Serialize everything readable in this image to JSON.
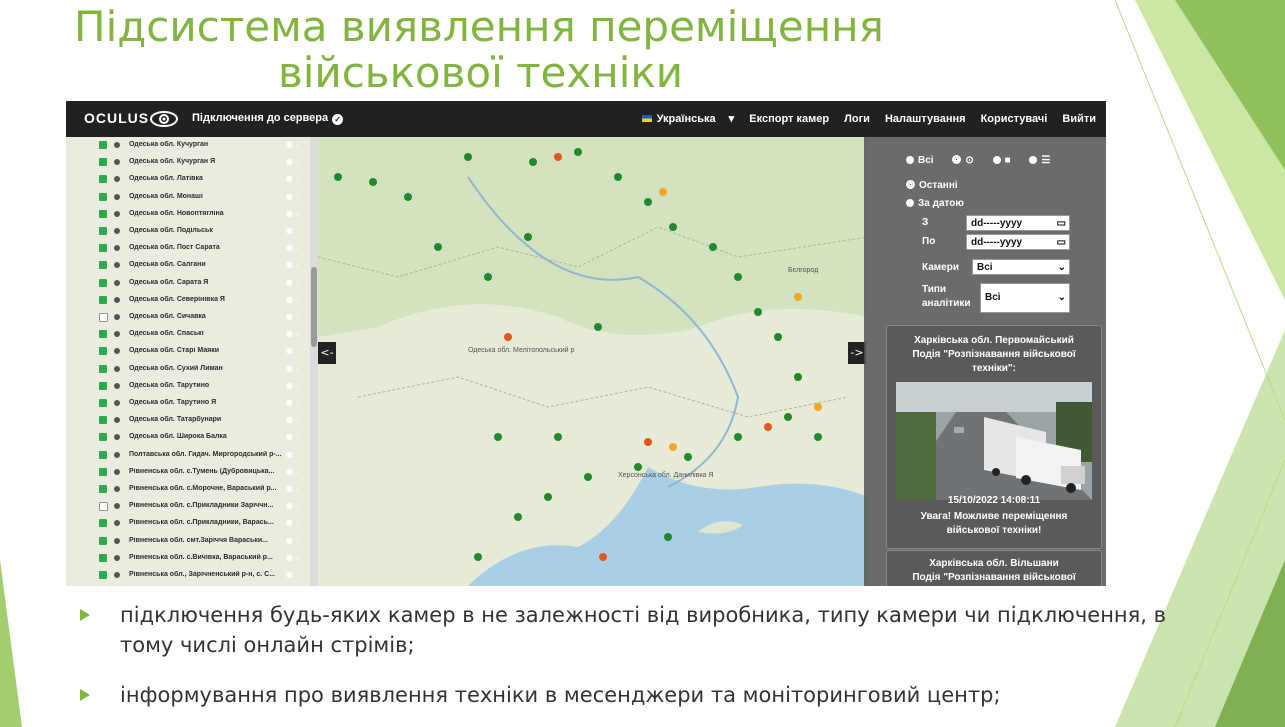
{
  "slide": {
    "title_line1": "Підсистема виявлення переміщення",
    "title_line2": "військової техніки",
    "accent_color": "#82b440",
    "bullets": [
      "підключення будь-яких камер в не залежності від виробника, типу камери чи підключення, в тому числі онлайн стрімів;",
      "інформування про виявлення техніки в месенджери та моніторинговий центр;"
    ]
  },
  "navbar": {
    "brand": "OCULUS",
    "brand_icon": "eye-icon",
    "server_status": "Підключення до сервера",
    "language": "Українська",
    "links": [
      "Експорт камер",
      "Логи",
      "Налаштування",
      "Користувачі",
      "Вийти"
    ]
  },
  "sidebar": {
    "cameras": [
      {
        "name": "Одеська обл. Кучурган",
        "checked": true
      },
      {
        "name": "Одеська обл. Кучурган Я",
        "checked": true
      },
      {
        "name": "Одеська обл. Латівка",
        "checked": true
      },
      {
        "name": "Одеська обл. Монаші",
        "checked": true
      },
      {
        "name": "Одеська обл. Новоптягліна",
        "checked": true
      },
      {
        "name": "Одеська обл. Подільськ",
        "checked": true
      },
      {
        "name": "Одеська обл. Пост Сарата",
        "checked": true
      },
      {
        "name": "Одеська обл. Салгани",
        "checked": true
      },
      {
        "name": "Одеська обл. Сарата Я",
        "checked": true
      },
      {
        "name": "Одеська обл. Северінівка Я",
        "checked": true
      },
      {
        "name": "Одеська обл. Сичавка",
        "checked": false
      },
      {
        "name": "Одеська обл. Спаські",
        "checked": true
      },
      {
        "name": "Одеська обл. Старі Маяки",
        "checked": true
      },
      {
        "name": "Одеська обл. Сухий Лиман",
        "checked": true
      },
      {
        "name": "Одеська обл. Тарутино",
        "checked": true
      },
      {
        "name": "Одеська обл. Тарутино Я",
        "checked": true
      },
      {
        "name": "Одеська обл. Татарбунари",
        "checked": true
      },
      {
        "name": "Одеська обл. Широка Балка",
        "checked": true
      },
      {
        "name": "Полтавська обл. Гидач. Миргородський р-...",
        "checked": true
      },
      {
        "name": "Рівненська обл. с.Тумень (Дубровицька...",
        "checked": true
      },
      {
        "name": "Рівненська обл. с.Морочне, Варaський р...",
        "checked": true
      },
      {
        "name": "Рівненська обл. с.Прикладники Заріччн...",
        "checked": false
      },
      {
        "name": "Рівненська обл. с.Прикладники, Варась...",
        "checked": true
      },
      {
        "name": "Рівненська обл. смт.Заріччя Варaськи...",
        "checked": true
      },
      {
        "name": "Рівненська обл. с.Вичівка, Варaський р...",
        "checked": true
      },
      {
        "name": "Рівненська обл., Зарічненський р-н, с. С...",
        "checked": true
      }
    ]
  },
  "map": {
    "left_arrow": "<-",
    "right_arrow": "->",
    "labels": [
      "Одеська обл. Мелітопольський р",
      "Херсонська обл. Данилівка Я",
      "Бєлгород"
    ]
  },
  "filters": {
    "all_label": "Всі",
    "mode_icons": [
      "camera-cctv-icon",
      "video-icon",
      "list-icon"
    ],
    "latest_label": "Останні",
    "by_date_label": "За датою",
    "from_label": "З",
    "to_label": "По",
    "date_placeholder": "dd-----yyyy",
    "cameras_label": "Камери",
    "cameras_value": "Всі",
    "analytics_label_1": "Типи",
    "analytics_label_2": "аналітики",
    "analytics_value": "Всі"
  },
  "events": [
    {
      "location": "Харківська обл. Первомайський",
      "event": "Подія \"Розпізнавання військової техніки\":",
      "timestamp": "15/10/2022 14:08:11",
      "warning": "Увага! Можливе переміщення військової техніки!"
    },
    {
      "location": "Харківська обл. Вільшани",
      "event": "Подія \"Розпізнавання військової"
    }
  ]
}
